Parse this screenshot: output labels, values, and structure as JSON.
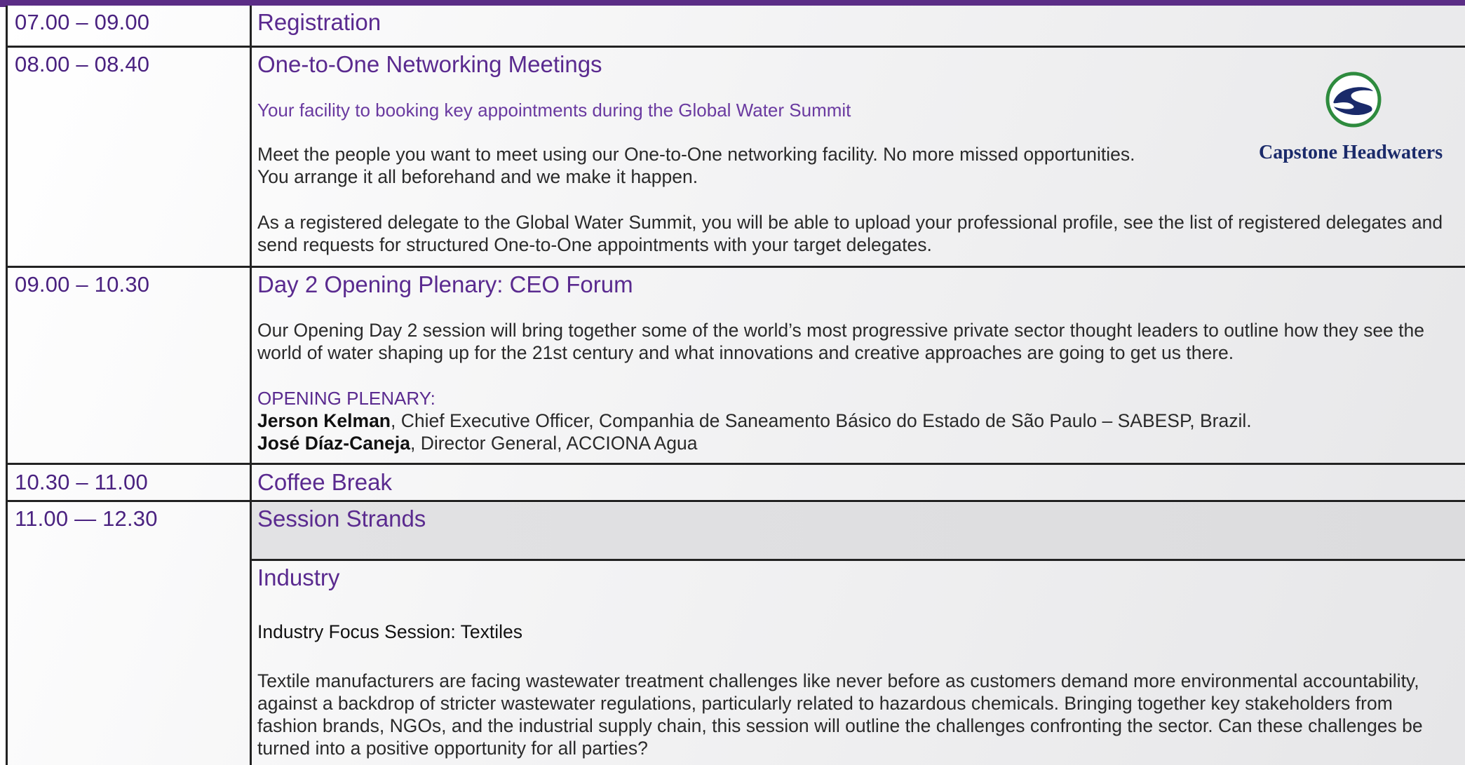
{
  "colors": {
    "accent": "#5b2d86",
    "heading": "#5a2a8f",
    "logo_green": "#2e8b3e",
    "logo_navy": "#1a2a6a"
  },
  "rows": [
    {
      "time": "07.00 – 09.00",
      "title": "Registration"
    },
    {
      "time": "08.00 – 08.40",
      "title": "One-to-One Networking Meetings",
      "subtitle": "Your facility to booking key appointments during the Global Water Summit",
      "para1_line1": "Meet the people you want to meet using our One-to-One networking facility. No more missed opportunities.",
      "para1_line2": "You arrange it all beforehand and we make it happen.",
      "para2_line1": "As a registered delegate to the Global Water Summit, you will be able to upload your professional profile, see the list of registered delegates and",
      "para2_line2": "send requests for structured One-to-One appointments with your target delegates.",
      "logo_text": "Capstone Headwaters"
    },
    {
      "time": "09.00 – 10.30",
      "title": "Day 2 Opening Plenary: CEO Forum",
      "para_line1": "Our Opening Day 2 session will bring together some of the world’s most progressive private sector thought leaders to outline how they see the",
      "para_line2": "world of water shaping up for the 21st century and what innovations and creative approaches are going to get us there.",
      "label": "OPENING PLENARY:",
      "speakers": [
        {
          "name": "Jerson Kelman",
          "role": ", Chief Executive Officer, Companhia de Saneamento Básico do Estado de São Paulo – SABESP, Brazil."
        },
        {
          "name": "José Díaz-Caneja",
          "role": ", Director General, ACCIONA Agua"
        }
      ]
    },
    {
      "time": "10.30 – 11.00",
      "title": "Coffee Break"
    },
    {
      "time": "11.00 — 12.30",
      "title": "Session Strands",
      "strand_title": "Industry",
      "focus": "Industry Focus Session: Textiles",
      "para_lines": [
        "Textile manufacturers are facing wastewater treatment challenges like never before as customers demand more environmental accountability,",
        "against a backdrop of stricter wastewater regulations, particularly related to hazardous chemicals. Bringing together key stakeholders from",
        "fashion brands, NGOs, and the industrial supply chain, this session will outline the challenges confronting the sector. Can these challenges be",
        "turned into a positive opportunity for all parties?"
      ]
    }
  ]
}
